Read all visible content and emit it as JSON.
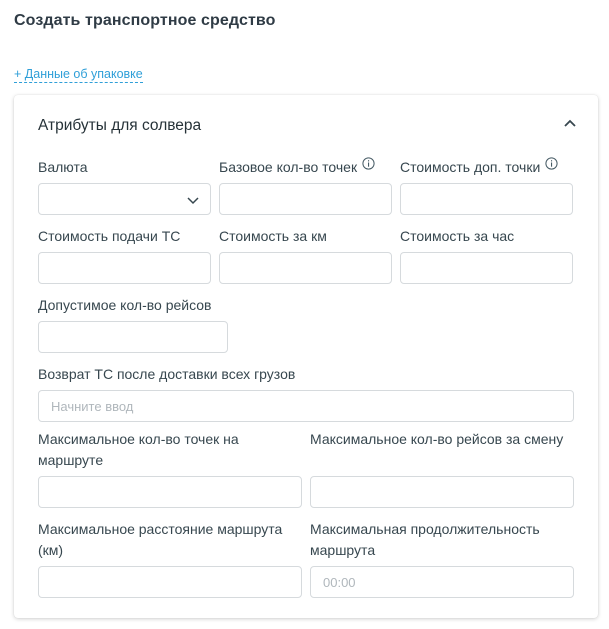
{
  "page": {
    "title": "Создать транспортное средство",
    "pack_link": "+ Данные об упаковке"
  },
  "card": {
    "title": "Атрибуты для солвера",
    "collapse_icon": "chevron-up-icon"
  },
  "fields": {
    "currency": {
      "label": "Валюта",
      "value": ""
    },
    "base_points": {
      "label": "Базовое кол-во точек",
      "value": ""
    },
    "extra_point_cost": {
      "label": "Стоимость доп. точки",
      "value": ""
    },
    "dispatch_cost": {
      "label": "Стоимость подачи ТС",
      "value": ""
    },
    "km_cost": {
      "label": "Стоимость за км",
      "value": ""
    },
    "hour_cost": {
      "label": "Стоимость за час",
      "value": ""
    },
    "allowed_trips": {
      "label": "Допустимое кол-во рейсов",
      "value": ""
    },
    "return_vehicle": {
      "label": "Возврат ТС после доставки всех грузов",
      "placeholder": "Начните ввод"
    },
    "max_route_points": {
      "label": "Максимальное кол-во точек на маршруте",
      "value": ""
    },
    "max_shift_trips": {
      "label": "Максимальное кол-во рейсов за смену",
      "value": ""
    },
    "max_route_distance": {
      "label": "Максимальное расстояние маршрута (км)",
      "value": ""
    },
    "max_route_duration": {
      "label": "Максимальная продолжительность маршрута",
      "placeholder": "00:00"
    }
  },
  "colors": {
    "link": "#2f9fd8",
    "border": "#d6dadd",
    "text": "#37474f"
  }
}
